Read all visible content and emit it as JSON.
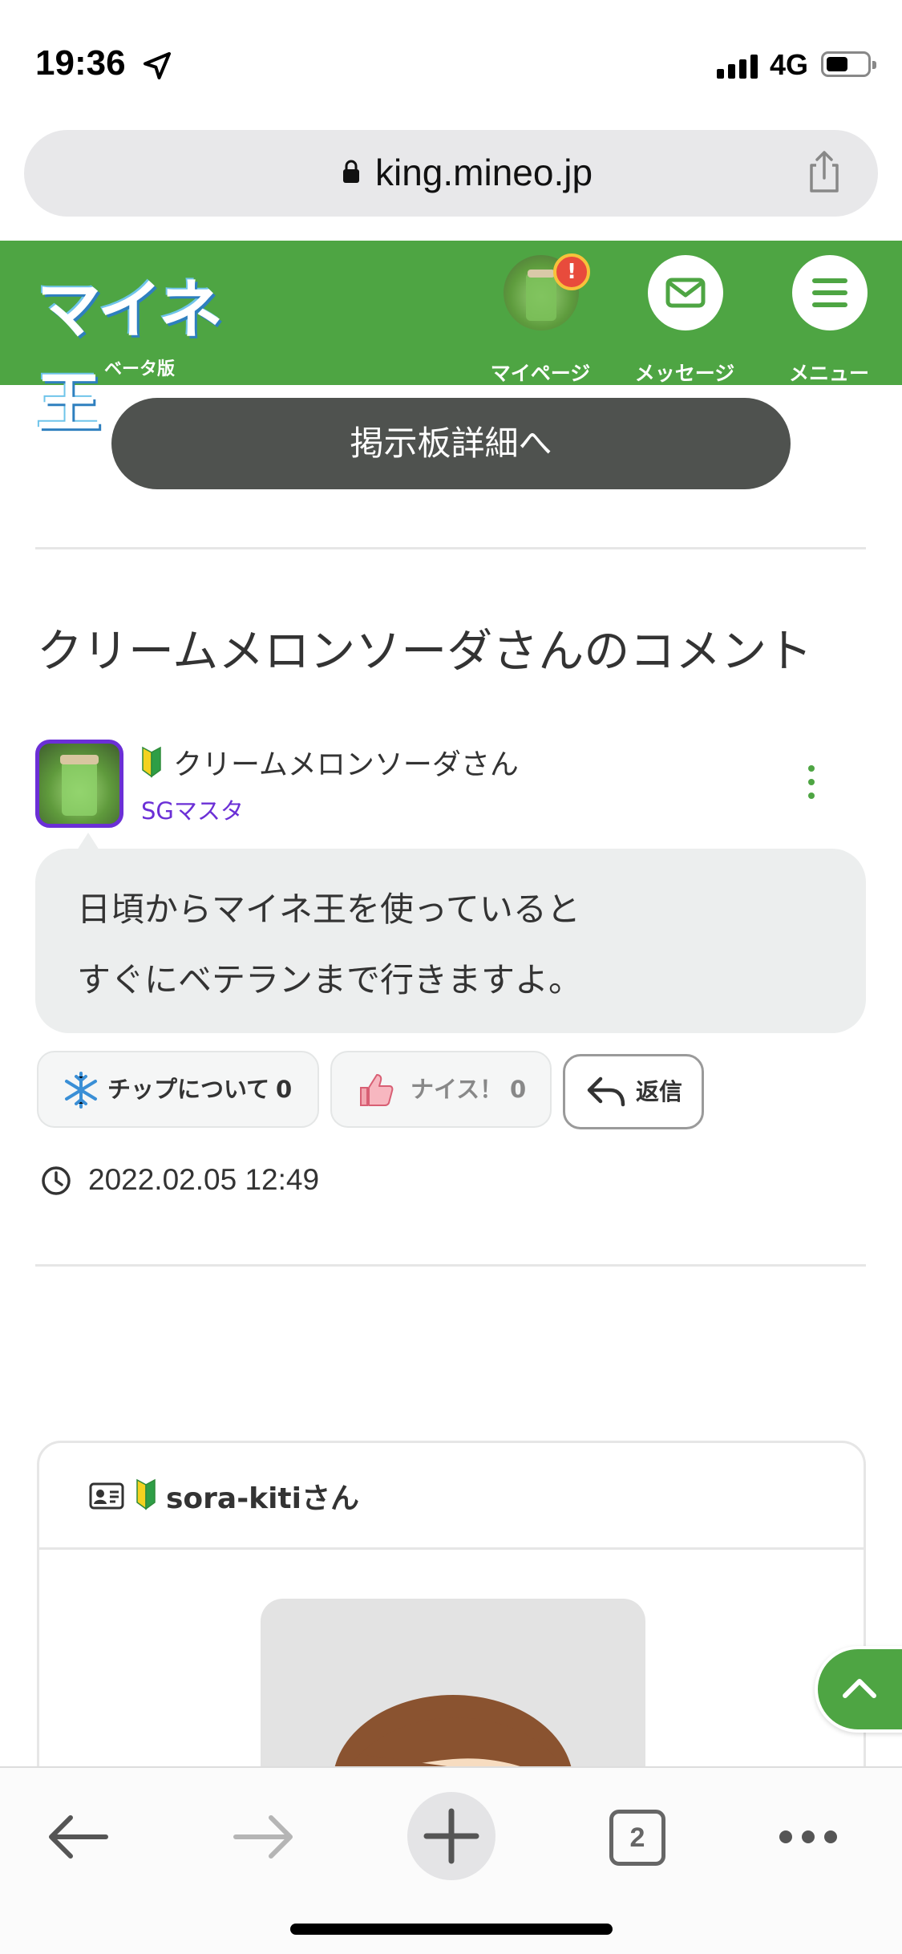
{
  "status_bar": {
    "time": "19:36",
    "network": "4G",
    "icons": [
      "location-arrow-icon",
      "signal-bars-icon",
      "battery-icon"
    ]
  },
  "browser": {
    "url": "king.mineo.jp",
    "icons": [
      "lock-icon",
      "share-icon"
    ],
    "toolbar_tab_count": "2",
    "toolbar_icons": [
      "back-arrow-icon",
      "forward-arrow-icon",
      "plus-icon",
      "tabs-icon",
      "more-dots-icon"
    ]
  },
  "header": {
    "logo_text": "マイネ王",
    "logo_sub": "ベータ版",
    "nav": {
      "mypage": "マイページ",
      "messages": "メッセージ",
      "menu": "メニュー"
    },
    "alert_badge": "!",
    "colors": {
      "brand_green": "#4ea543",
      "alert_red": "#e84b3c"
    }
  },
  "main": {
    "board_button": "掲示板詳細へ",
    "section_title": "クリームメロンソーダさんのコメント",
    "comment": {
      "user": "クリームメロンソーダさん",
      "rank": "SGマスタ",
      "body_line1": "日頃からマイネ王を使っていると",
      "body_line2": "すぐにベテランまで行きますよ。",
      "tip_label": "チップについて",
      "tip_count": "0",
      "nice_label": "ナイス！",
      "nice_count": "0",
      "reply_label": "返信",
      "timestamp": "2022.02.05 12:49",
      "rank_color": "#6b2fd6"
    },
    "profile_card": {
      "name": "sora-kitiさん"
    }
  }
}
